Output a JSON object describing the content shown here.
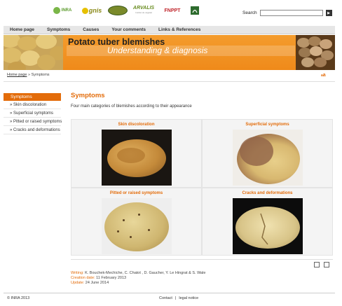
{
  "logos": [
    {
      "text": "INRA",
      "icon": "inra-logo"
    },
    {
      "text": "gnis",
      "icon": "gnis-logo"
    },
    {
      "text": "",
      "icon": "potato-oval-logo"
    },
    {
      "text": "ARVALIS",
      "icon": "arvalis-logo",
      "tagline": "Institut du végétal"
    },
    {
      "text": "FNPPT",
      "icon": "fnppt-logo"
    },
    {
      "text": "",
      "icon": "plant-logo"
    }
  ],
  "search": {
    "label": "Search",
    "placeholder": "",
    "go_icon": "play-arrow-icon"
  },
  "nav": {
    "items": [
      "Home page",
      "Symptoms",
      "Causes",
      "Your comments",
      "Links & References"
    ]
  },
  "banner": {
    "title": "Potato tuber blemishes",
    "subtitle": "Understanding & diagnosis",
    "color": "#ef8a1a"
  },
  "breadcrumb": {
    "home": "Home page",
    "separator": "»",
    "current": "Symptoms"
  },
  "font_tool": {
    "label": "a"
  },
  "sidebar": {
    "active": "Symptoms",
    "items": [
      "Skin discoloration",
      "Superficial symptoms",
      "Pitted or raised symptoms",
      "Cracks and deformations"
    ]
  },
  "main": {
    "title": "Symptoms",
    "intro": "Four main categories of blemishes according to their appearance",
    "categories": [
      {
        "label": "Skin discoloration"
      },
      {
        "label": "Superficial symptoms"
      },
      {
        "label": "Pitted or raised symptoms"
      },
      {
        "label": "Cracks and deformations"
      }
    ]
  },
  "credits": {
    "writing_label": "Writing:",
    "writing": "K. Bouchek-Mechiche, C. Chatot , D. Gaucher, Y. Le Hingrat & S. Wale",
    "creation_label": "Creation date:",
    "creation": "11 February 2013",
    "update_label": "Update:",
    "update": "24 June 2014"
  },
  "footer": {
    "copyright": "© INRA 2013",
    "contact": "Contact",
    "separator": "|",
    "legal": "legal notice"
  },
  "colors": {
    "accent": "#e36c0a",
    "nav_bg": "#e6e6e6"
  }
}
